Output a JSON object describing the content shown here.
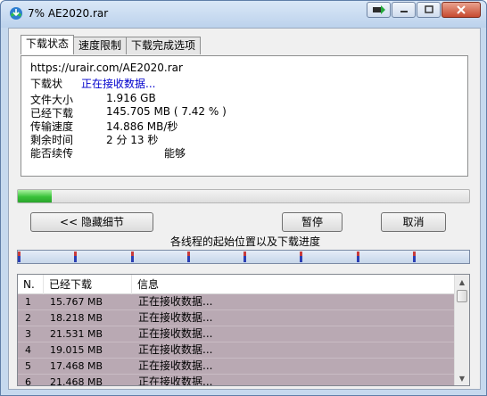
{
  "window": {
    "title": "7% AE2020.rar"
  },
  "tabs": [
    {
      "label": "下载状态",
      "active": true
    },
    {
      "label": "速度限制",
      "active": false
    },
    {
      "label": "下载完成选项",
      "active": false
    }
  ],
  "status": {
    "url": "https://urair.com/AE2020.rar",
    "state_label": "下载状",
    "state_value": "正在接收数据...",
    "rows": [
      {
        "label": "文件大小",
        "value": "1.916  GB"
      },
      {
        "label": "已经下载",
        "value": "145.705  MB  ( 7.42 % )"
      },
      {
        "label": "传输速度",
        "value": "14.886  MB/秒"
      },
      {
        "label": "剩余时间",
        "value": "2 分 13 秒"
      },
      {
        "label": "能否续传",
        "value": "能够"
      }
    ]
  },
  "progress": {
    "percent": 7.42
  },
  "buttons": {
    "hide_details": "<< 隐藏细节",
    "pause": "暂停",
    "cancel": "取消"
  },
  "threads": {
    "caption": "各线程的起始位置以及下载进度",
    "marker_fractions": [
      0.0,
      0.125,
      0.25,
      0.375,
      0.5,
      0.625,
      0.75,
      0.875
    ]
  },
  "thread_list": {
    "headers": {
      "num": "N.",
      "downloaded": "已经下载",
      "info": "信息"
    },
    "rows": [
      {
        "num": "1",
        "downloaded": "15.767 MB",
        "info": "正在接收数据..."
      },
      {
        "num": "2",
        "downloaded": "18.218 MB",
        "info": "正在接收数据..."
      },
      {
        "num": "3",
        "downloaded": "21.531 MB",
        "info": "正在接收数据..."
      },
      {
        "num": "4",
        "downloaded": "19.015 MB",
        "info": "正在接收数据..."
      },
      {
        "num": "5",
        "downloaded": "17.468 MB",
        "info": "正在接收数据..."
      },
      {
        "num": "6",
        "downloaded": "21.468 MB",
        "info": "正在接收数据..."
      }
    ]
  },
  "colors": {
    "progress_green": "#39c23a",
    "row_background": "#b9a9b3",
    "status_blue": "#0000cc"
  }
}
